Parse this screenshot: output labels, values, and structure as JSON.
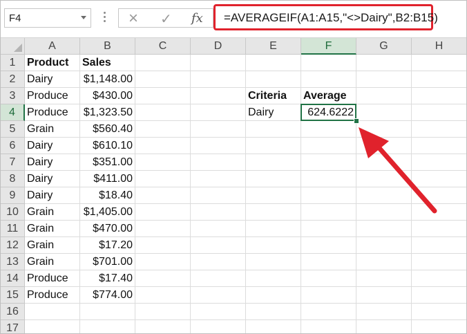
{
  "name_box": {
    "value": "F4"
  },
  "formula_bar": {
    "cancel_icon": "×",
    "enter_icon": "✓",
    "fx_label": "fx",
    "formula": "=AVERAGEIF(A1:A15,\"<>Dairy\",B2:B15)"
  },
  "sheet": {
    "columns": [
      "A",
      "B",
      "C",
      "D",
      "E",
      "F",
      "G",
      "H"
    ],
    "rows": [
      "1",
      "2",
      "3",
      "4",
      "5",
      "6",
      "7",
      "8",
      "9",
      "10",
      "11",
      "12",
      "13",
      "14",
      "15",
      "16",
      "17"
    ],
    "selected_column": "F",
    "selected_row": "4",
    "active_cell": "F4",
    "cells": {
      "A1": "Product",
      "B1": "Sales",
      "A2": "Dairy",
      "B2": "$1,148.00",
      "A3": "Produce",
      "B3": "$430.00",
      "A4": "Produce",
      "B4": "$1,323.50",
      "A5": "Grain",
      "B5": "$560.40",
      "A6": "Dairy",
      "B6": "$610.10",
      "A7": "Dairy",
      "B7": "$351.00",
      "A8": "Dairy",
      "B8": "$411.00",
      "A9": "Dairy",
      "B9": "$18.40",
      "A10": "Grain",
      "B10": "$1,405.00",
      "A11": "Grain",
      "B11": "$470.00",
      "A12": "Grain",
      "B12": "$17.20",
      "A13": "Grain",
      "B13": "$701.00",
      "A14": "Produce",
      "B14": "$17.40",
      "A15": "Produce",
      "B15": "$774.00",
      "E3": "Criteria",
      "F3": "Average",
      "E4": "Dairy",
      "F4": "624.6222"
    },
    "bold_cells": [
      "A1",
      "B1",
      "E3",
      "F3"
    ],
    "number_cells": [
      "B2",
      "B3",
      "B4",
      "B5",
      "B6",
      "B7",
      "B8",
      "B9",
      "B10",
      "B11",
      "B12",
      "B13",
      "B14",
      "B15",
      "F4"
    ]
  },
  "annotation": {
    "arrow_color": "#e0222c",
    "highlight_color": "#e0222c"
  },
  "colors": {
    "accent": "#217346"
  }
}
